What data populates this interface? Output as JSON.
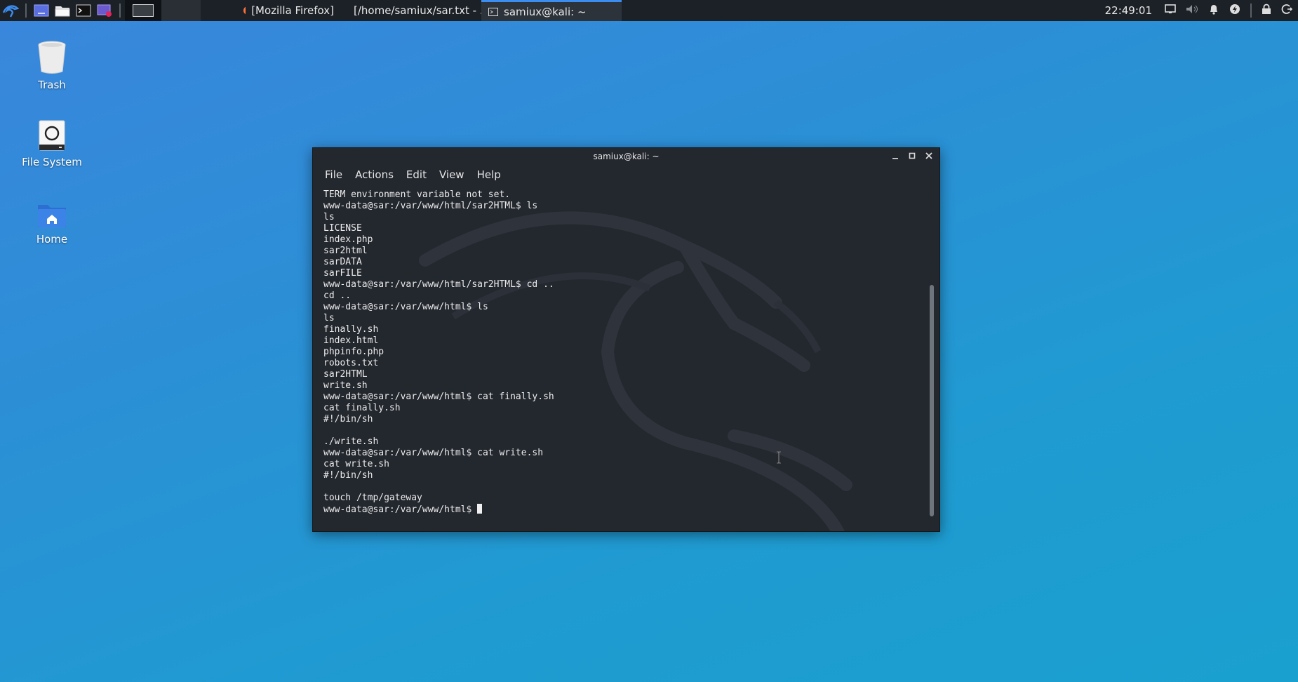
{
  "panel": {
    "tasks": [
      {
        "label": "[Mozilla Firefox]"
      },
      {
        "label": "[/home/samiux/sar.txt - ..."
      },
      {
        "label": "samiux@kali: ~"
      }
    ],
    "clock": "22:49:01"
  },
  "desktop": {
    "icons": [
      {
        "label": "Trash"
      },
      {
        "label": "File System"
      },
      {
        "label": "Home"
      }
    ]
  },
  "window": {
    "title": "samiux@kali: ~",
    "menu": [
      "File",
      "Actions",
      "Edit",
      "View",
      "Help"
    ],
    "terminal_lines": [
      "TERM environment variable not set.",
      "www-data@sar:/var/www/html/sar2HTML$ ls",
      "ls",
      "LICENSE",
      "index.php",
      "sar2html",
      "sarDATA",
      "sarFILE",
      "www-data@sar:/var/www/html/sar2HTML$ cd ..",
      "cd ..",
      "www-data@sar:/var/www/html$ ls",
      "ls",
      "finally.sh",
      "index.html",
      "phpinfo.php",
      "robots.txt",
      "sar2HTML",
      "write.sh",
      "www-data@sar:/var/www/html$ cat finally.sh",
      "cat finally.sh",
      "#!/bin/sh",
      "",
      "./write.sh",
      "www-data@sar:/var/www/html$ cat write.sh",
      "cat write.sh",
      "#!/bin/sh",
      "",
      "touch /tmp/gateway"
    ],
    "prompt": "www-data@sar:/var/www/html$ "
  },
  "colors": {
    "panel_bg": "#1c2127",
    "terminal_bg": "#23272e",
    "accent": "#3b8df0"
  }
}
